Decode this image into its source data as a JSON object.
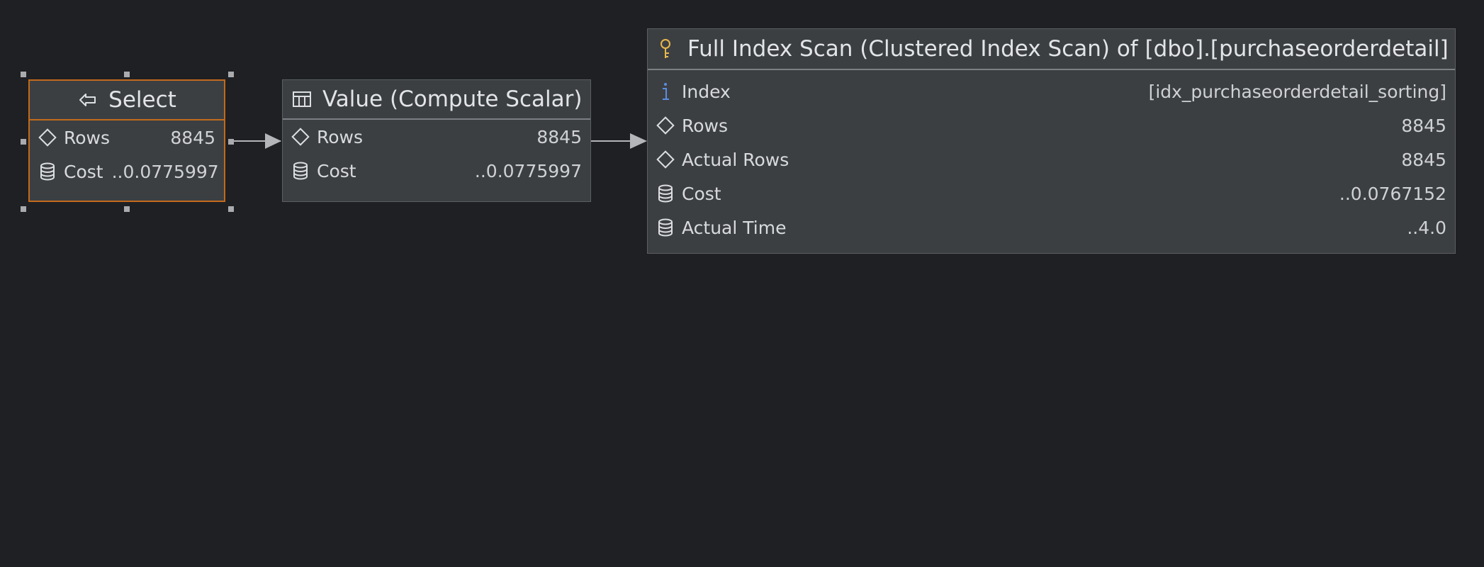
{
  "nodes": {
    "select": {
      "title": "Select",
      "rows": [
        {
          "label": "Rows",
          "value": "8845"
        },
        {
          "label": "Cost",
          "value": "..0.0775997"
        }
      ]
    },
    "compute": {
      "title": "Value (Compute Scalar)",
      "rows": [
        {
          "label": "Rows",
          "value": "8845"
        },
        {
          "label": "Cost",
          "value": "..0.0775997"
        }
      ]
    },
    "scan": {
      "title": "Full Index Scan (Clustered Index Scan) of [dbo].[purchaseorderdetail]",
      "rows": [
        {
          "label": "Index",
          "value": "[idx_purchaseorderdetail_sorting]"
        },
        {
          "label": "Rows",
          "value": "8845"
        },
        {
          "label": "Actual Rows",
          "value": "8845"
        },
        {
          "label": "Cost",
          "value": "..0.0767152"
        },
        {
          "label": "Actual Time",
          "value": "..4.0"
        }
      ]
    }
  },
  "icons": {
    "select": "arrow-left-icon",
    "compute": "table-icon",
    "scan": "key-icon",
    "rows": "diamond-icon",
    "cost": "database-icon",
    "index": "info-icon"
  },
  "colors": {
    "background": "#1f2023",
    "node": "#3c3f42",
    "selection": "#c26a1d",
    "key": "#e8b84a",
    "info": "#5b8de0"
  }
}
